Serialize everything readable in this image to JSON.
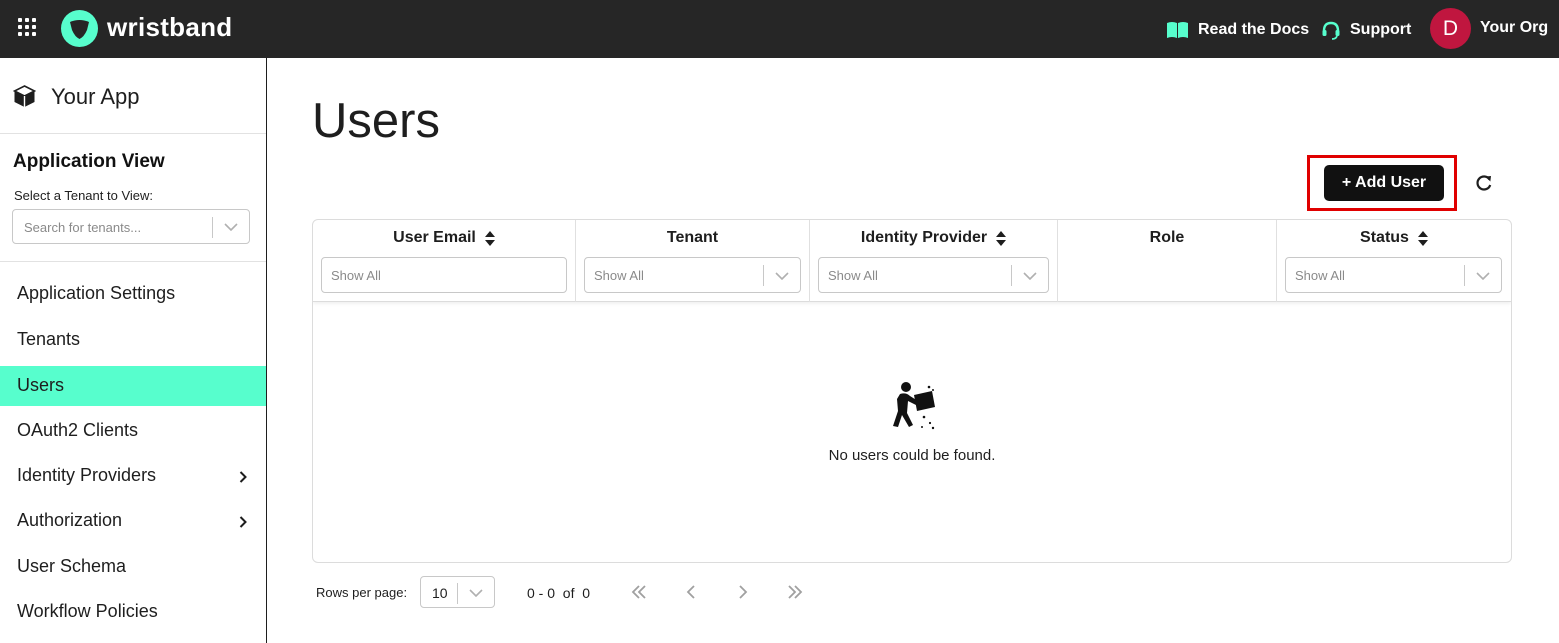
{
  "header": {
    "brand": "wristband",
    "docs_label": "Read the Docs",
    "support_label": "Support",
    "org_initial": "D",
    "org_name": "Your Org",
    "bg_color": "#262626",
    "accent_color": "#57fecd",
    "avatar_color": "#c0163f"
  },
  "sidebar": {
    "app_name": "Your App",
    "app_view_title": "Application View",
    "tenant_label": "Select a Tenant to View:",
    "tenant_placeholder": "Search for tenants...",
    "items": [
      {
        "label": "Application Settings",
        "has_submenu": false,
        "active": false
      },
      {
        "label": "Tenants",
        "has_submenu": false,
        "active": false
      },
      {
        "label": "Users",
        "has_submenu": false,
        "active": true
      },
      {
        "label": "OAuth2 Clients",
        "has_submenu": false,
        "active": false
      },
      {
        "label": "Identity Providers",
        "has_submenu": true,
        "active": false
      },
      {
        "label": "Authorization",
        "has_submenu": true,
        "active": false
      },
      {
        "label": "User Schema",
        "has_submenu": false,
        "active": false
      },
      {
        "label": "Workflow Policies",
        "has_submenu": false,
        "active": false
      }
    ]
  },
  "main": {
    "title": "Users",
    "add_user_label": "+ Add User",
    "table": {
      "columns": [
        {
          "label": "User Email",
          "sortable": true,
          "filter": "Show All",
          "filter_type": "text"
        },
        {
          "label": "Tenant",
          "sortable": false,
          "filter": "Show All",
          "filter_type": "select"
        },
        {
          "label": "Identity Provider",
          "sortable": true,
          "filter": "Show All",
          "filter_type": "select"
        },
        {
          "label": "Role",
          "sortable": false,
          "filter": "",
          "filter_type": "none"
        },
        {
          "label": "Status",
          "sortable": true,
          "filter": "Show All",
          "filter_type": "select"
        }
      ],
      "empty_message": "No users could be found."
    },
    "pagination": {
      "rows_label": "Rows per page:",
      "rows_value": "10",
      "range_text": "0 - 0  of  0"
    }
  },
  "icons": {
    "apps": "grid-icon",
    "logo": "wristband-logo",
    "docs": "book-icon",
    "support": "headset-icon",
    "app": "cube-icon",
    "refresh": "refresh-icon",
    "empty": "person-pushing-board-icon"
  }
}
